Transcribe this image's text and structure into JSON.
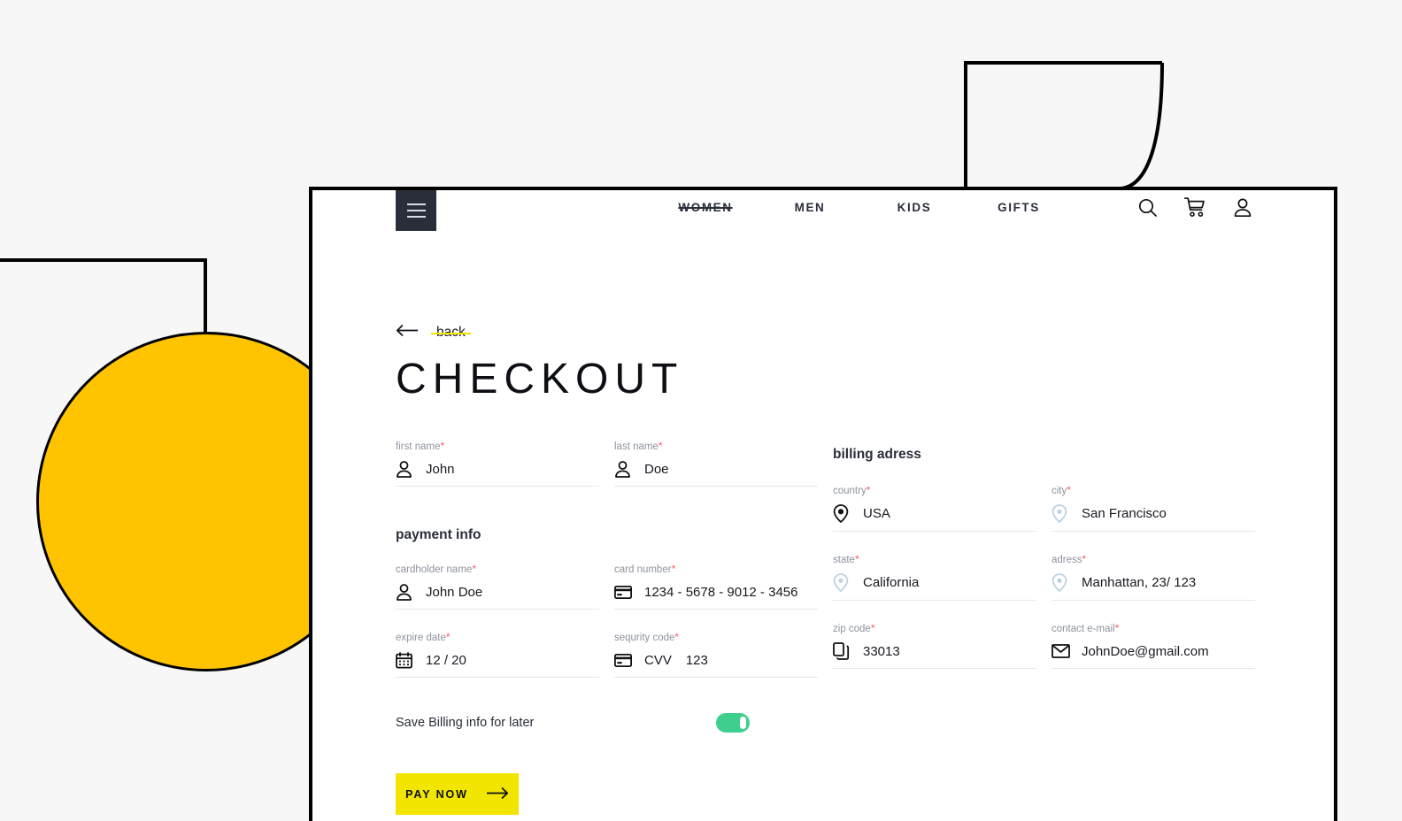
{
  "header": {
    "menu_icon": "hamburger-icon",
    "nav": [
      {
        "label": "WOMEN",
        "struck": true
      },
      {
        "label": "MEN",
        "struck": false
      },
      {
        "label": "KIDS",
        "struck": false
      },
      {
        "label": "GIFTS",
        "struck": false
      }
    ],
    "icons": [
      {
        "name": "search-icon"
      },
      {
        "name": "cart-icon"
      },
      {
        "name": "user-account-icon"
      }
    ]
  },
  "back": {
    "label": "back",
    "arrow_icon": "arrow-left-icon"
  },
  "page": {
    "title": "CHECKOUT"
  },
  "sections": {
    "payment_info": "payment info",
    "billing_address": "billing adress"
  },
  "fields": {
    "first_name": {
      "label": "first name",
      "required": "*",
      "value": "John",
      "icon": "person-icon"
    },
    "last_name": {
      "label": "last name",
      "required": "*",
      "value": "Doe",
      "icon": "person-icon"
    },
    "cardholder_name": {
      "label": "cardholder name",
      "required": "*",
      "value": "John Doe",
      "icon": "person-icon"
    },
    "card_number": {
      "label": "card number",
      "required": "*",
      "value": "1234 - 5678 - 9012 - 3456",
      "icon": "credit-card-icon"
    },
    "expire_date": {
      "label": "expire date",
      "required": "*",
      "value": "12 / 20",
      "icon": "calendar-icon"
    },
    "security_code": {
      "label": "sequrity code",
      "required": "*",
      "value_prefix": "CVV",
      "value": "123",
      "icon": "credit-card-icon"
    },
    "country": {
      "label": "country",
      "required": "*",
      "value": "USA",
      "icon": "map-pin-filled-icon"
    },
    "city": {
      "label": "city",
      "required": "*",
      "value": "San Francisco",
      "icon": "map-pin-outline-icon"
    },
    "state": {
      "label": "state",
      "required": "*",
      "value": "California",
      "icon": "map-pin-outline-icon"
    },
    "address": {
      "label": "adress",
      "required": "*",
      "value": "Manhattan, 23/ 123",
      "icon": "map-pin-outline-icon"
    },
    "zip_code": {
      "label": "zip code",
      "required": "*",
      "value": "33013",
      "icon": "copy-documents-icon"
    },
    "contact_email": {
      "label": "contact e-mail",
      "required": "*",
      "value": "JohnDoe@gmail.com",
      "icon": "envelope-icon"
    }
  },
  "save_billing": {
    "label": "Save Billing info for later",
    "toggle_on": true
  },
  "pay_button": {
    "label": "PAY NOW",
    "arrow_icon": "arrow-right-icon"
  },
  "colors": {
    "accent_yellow": "#F2E500",
    "circle_amber": "#FFC300",
    "toggle_green": "#3ECF8E",
    "required_red": "#ff5964",
    "dark_navy": "#2A2E3A",
    "page_background": "#f7f7f7",
    "pin_light": "#bcd2e0"
  }
}
